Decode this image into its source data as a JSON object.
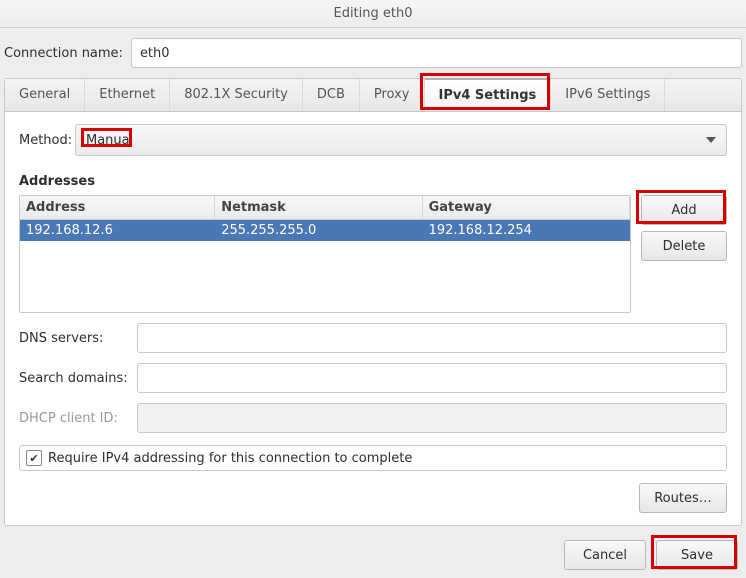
{
  "window": {
    "title": "Editing eth0"
  },
  "connection_name": {
    "label": "Connection name:",
    "value": "eth0"
  },
  "tabs": [
    {
      "id": "general",
      "label": "General"
    },
    {
      "id": "ethernet",
      "label": "Ethernet"
    },
    {
      "id": "8021x",
      "label": "802.1X Security"
    },
    {
      "id": "dcb",
      "label": "DCB"
    },
    {
      "id": "proxy",
      "label": "Proxy"
    },
    {
      "id": "ipv4",
      "label": "IPv4 Settings",
      "active": true
    },
    {
      "id": "ipv6",
      "label": "IPv6 Settings"
    }
  ],
  "method": {
    "label": "Method:",
    "value": "Manual"
  },
  "addresses": {
    "section_label": "Addresses",
    "columns": {
      "address": "Address",
      "netmask": "Netmask",
      "gateway": "Gateway"
    },
    "rows": [
      {
        "address": "192.168.12.6",
        "netmask": "255.255.255.0",
        "gateway": "192.168.12.254",
        "selected": true
      }
    ],
    "add_label": "Add",
    "delete_label": "Delete"
  },
  "dns": {
    "label": "DNS servers:",
    "value": ""
  },
  "search": {
    "label": "Search domains:",
    "value": ""
  },
  "dhcp": {
    "label": "DHCP client ID:",
    "value": "",
    "disabled": true
  },
  "require_ipv4": {
    "checked": true,
    "label": "Require IPv4 addressing for this connection to complete"
  },
  "routes_label": "Routes…",
  "footer": {
    "cancel": "Cancel",
    "save": "Save"
  },
  "highlights": [
    {
      "target": "tab-ipv4"
    },
    {
      "target": "method-select-inner"
    },
    {
      "target": "add-button"
    },
    {
      "target": "save-button"
    }
  ]
}
